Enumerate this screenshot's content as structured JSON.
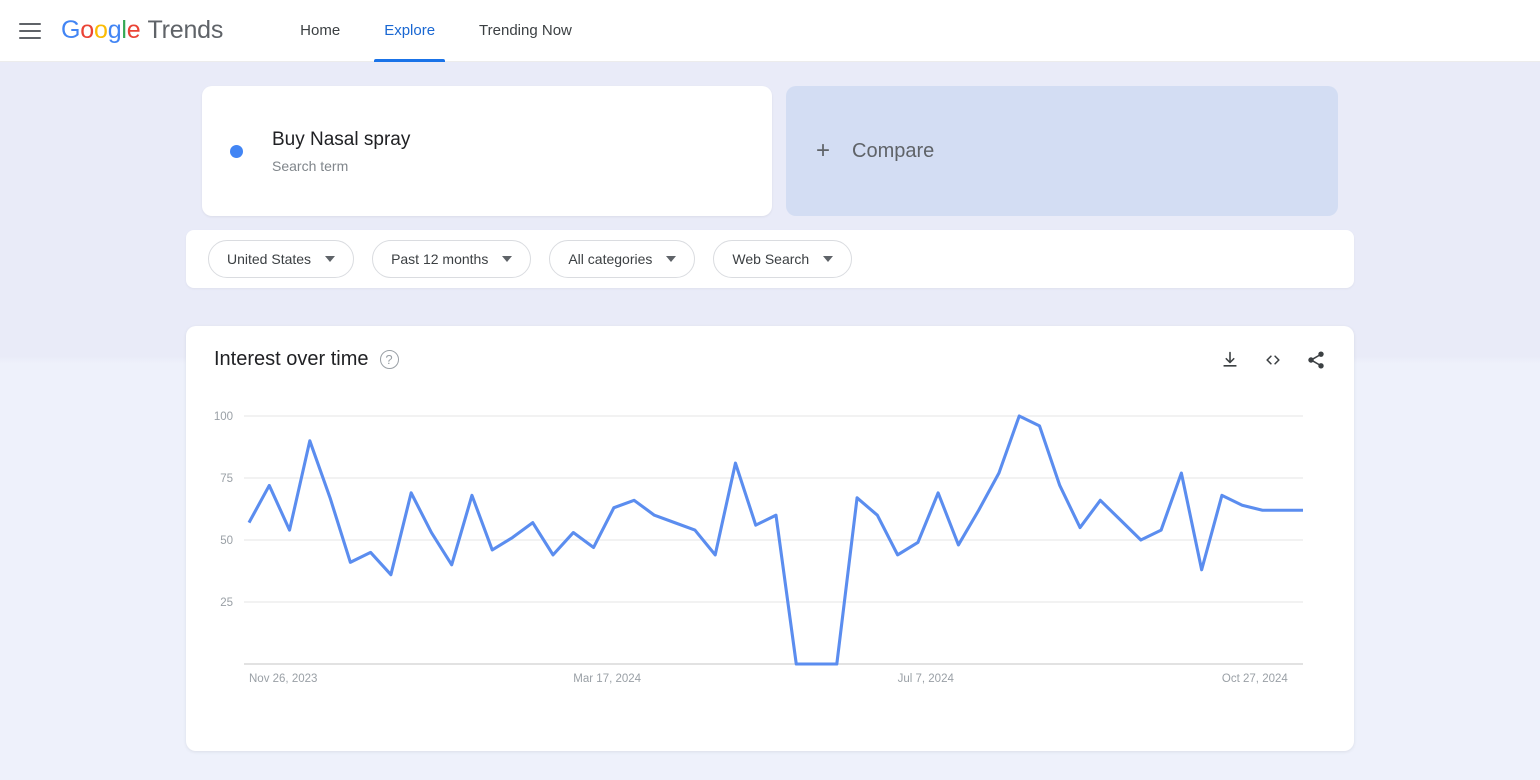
{
  "header": {
    "menu_icon": "hamburger-menu-icon",
    "brand_google": "Google",
    "brand_product": "Trends",
    "nav": [
      {
        "label": "Home",
        "active": false
      },
      {
        "label": "Explore",
        "active": true
      },
      {
        "label": "Trending Now",
        "active": false
      }
    ]
  },
  "query": {
    "term": {
      "title": "Buy Nasal spray",
      "subtitle": "Search term",
      "dot_color": "#4285f4"
    },
    "compare": {
      "label": "Compare",
      "plus": "+"
    }
  },
  "filters": [
    {
      "label": "United States"
    },
    {
      "label": "Past 12 months"
    },
    {
      "label": "All categories"
    },
    {
      "label": "Web Search"
    }
  ],
  "chart_card": {
    "title": "Interest over time",
    "help": "?",
    "actions": [
      {
        "name": "download-icon",
        "tooltip": "Download"
      },
      {
        "name": "embed-code-icon",
        "tooltip": "Embed"
      },
      {
        "name": "share-icon",
        "tooltip": "Share"
      }
    ]
  },
  "chart_data": {
    "type": "line",
    "title": "Interest over time",
    "xlabel": "",
    "ylabel": "",
    "ylim": [
      0,
      100
    ],
    "yticks": [
      25,
      50,
      75,
      100
    ],
    "grid": true,
    "legend": false,
    "line_color": "#5b8def",
    "xticks": [
      "Nov 26, 2023",
      "Mar 17, 2024",
      "Jul 7, 2024",
      "Oct 27, 2024"
    ],
    "xtick_index": [
      0,
      16,
      32,
      48
    ],
    "series": [
      {
        "name": "Buy Nasal spray",
        "color": "#5b8def",
        "values": [
          57,
          72,
          54,
          90,
          67,
          41,
          45,
          36,
          69,
          53,
          40,
          68,
          46,
          51,
          57,
          44,
          53,
          47,
          63,
          66,
          60,
          57,
          54,
          44,
          81,
          56,
          60,
          0,
          0,
          0,
          67,
          60,
          44,
          49,
          69,
          48,
          62,
          77,
          100,
          96,
          72,
          55,
          66,
          58,
          50,
          54,
          77,
          38,
          68,
          64,
          62,
          62,
          62
        ]
      }
    ]
  }
}
